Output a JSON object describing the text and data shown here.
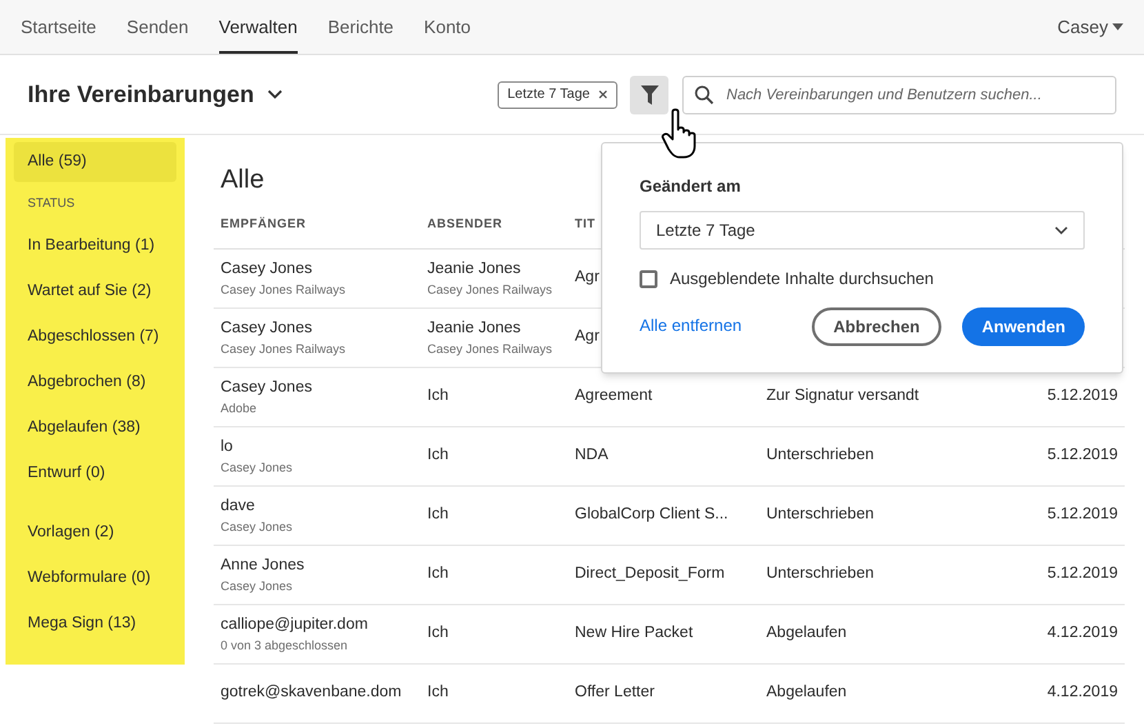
{
  "nav": {
    "tabs": [
      {
        "label": "Startseite",
        "selected": false
      },
      {
        "label": "Senden",
        "selected": false
      },
      {
        "label": "Verwalten",
        "selected": true
      },
      {
        "label": "Berichte",
        "selected": false
      },
      {
        "label": "Konto",
        "selected": false
      }
    ],
    "user": "Casey"
  },
  "header": {
    "title": "Ihre Vereinbarungen",
    "filter_chip": "Letzte 7 Tage",
    "search": {
      "placeholder": "Nach Vereinbarungen und Benutzern suchen..."
    }
  },
  "sidebar": {
    "items": [
      {
        "kind": "item",
        "label": "Alle (59)",
        "selected": true
      },
      {
        "kind": "heading",
        "label": "STATUS"
      },
      {
        "kind": "item",
        "label": "In Bearbeitung (1)",
        "selected": false
      },
      {
        "kind": "item",
        "label": "Wartet auf Sie (2)",
        "selected": false
      },
      {
        "kind": "item",
        "label": "Abgeschlossen (7)",
        "selected": false
      },
      {
        "kind": "item",
        "label": "Abgebrochen (8)",
        "selected": false
      },
      {
        "kind": "item",
        "label": "Abgelaufen (38)",
        "selected": false
      },
      {
        "kind": "item",
        "label": "Entwurf (0)",
        "selected": false
      },
      {
        "kind": "gap"
      },
      {
        "kind": "item",
        "label": "Vorlagen (2)",
        "selected": false
      },
      {
        "kind": "item",
        "label": "Webformulare (0)",
        "selected": false
      },
      {
        "kind": "item",
        "label": "Mega Sign (13)",
        "selected": false
      }
    ]
  },
  "table": {
    "title": "Alle",
    "columns": [
      "EMPFÄNGER",
      "ABSENDER",
      "TIT"
    ],
    "rows": [
      {
        "recipient": "Casey Jones",
        "recipient_sub": "Casey Jones Railways",
        "sender": "Jeanie Jones",
        "sender_sub": "Casey Jones Railways",
        "title": "Agr"
      },
      {
        "recipient": "Casey Jones",
        "recipient_sub": "Casey Jones Railways",
        "sender": "Jeanie Jones",
        "sender_sub": "Casey Jones Railways",
        "title": "Agr"
      },
      {
        "recipient": "Casey Jones",
        "recipient_sub": "Adobe",
        "sender": "Ich",
        "title": "Agreement",
        "status": "Zur Signatur versandt",
        "date": "5.12.2019"
      },
      {
        "recipient": "lo",
        "recipient_sub": "Casey Jones",
        "sender": "Ich",
        "title": "NDA",
        "status": "Unterschrieben",
        "date": "5.12.2019"
      },
      {
        "recipient": "dave",
        "recipient_sub": "Casey Jones",
        "sender": "Ich",
        "title": "GlobalCorp Client S...",
        "status": "Unterschrieben",
        "date": "5.12.2019"
      },
      {
        "recipient": "Anne Jones",
        "recipient_sub": "Casey Jones",
        "sender": "Ich",
        "title": "Direct_Deposit_Form",
        "status": "Unterschrieben",
        "date": "5.12.2019"
      },
      {
        "recipient": "calliope@jupiter.dom",
        "recipient_sub": "0 von 3 abgeschlossen",
        "sender": "Ich",
        "title": "New Hire Packet",
        "status": "Abgelaufen",
        "date": "4.12.2019"
      },
      {
        "recipient": "gotrek@skavenbane.dom",
        "sender": "Ich",
        "title": "Offer Letter",
        "status": "Abgelaufen",
        "date": "4.12.2019"
      }
    ]
  },
  "filter_popover": {
    "label": "Geändert am",
    "select_value": "Letzte 7 Tage",
    "checkbox": {
      "label": "Ausgeblendete Inhalte durchsuchen",
      "checked": false
    },
    "clear_link": "Alle entfernen",
    "cancel": "Abbrechen",
    "apply": "Anwenden"
  }
}
